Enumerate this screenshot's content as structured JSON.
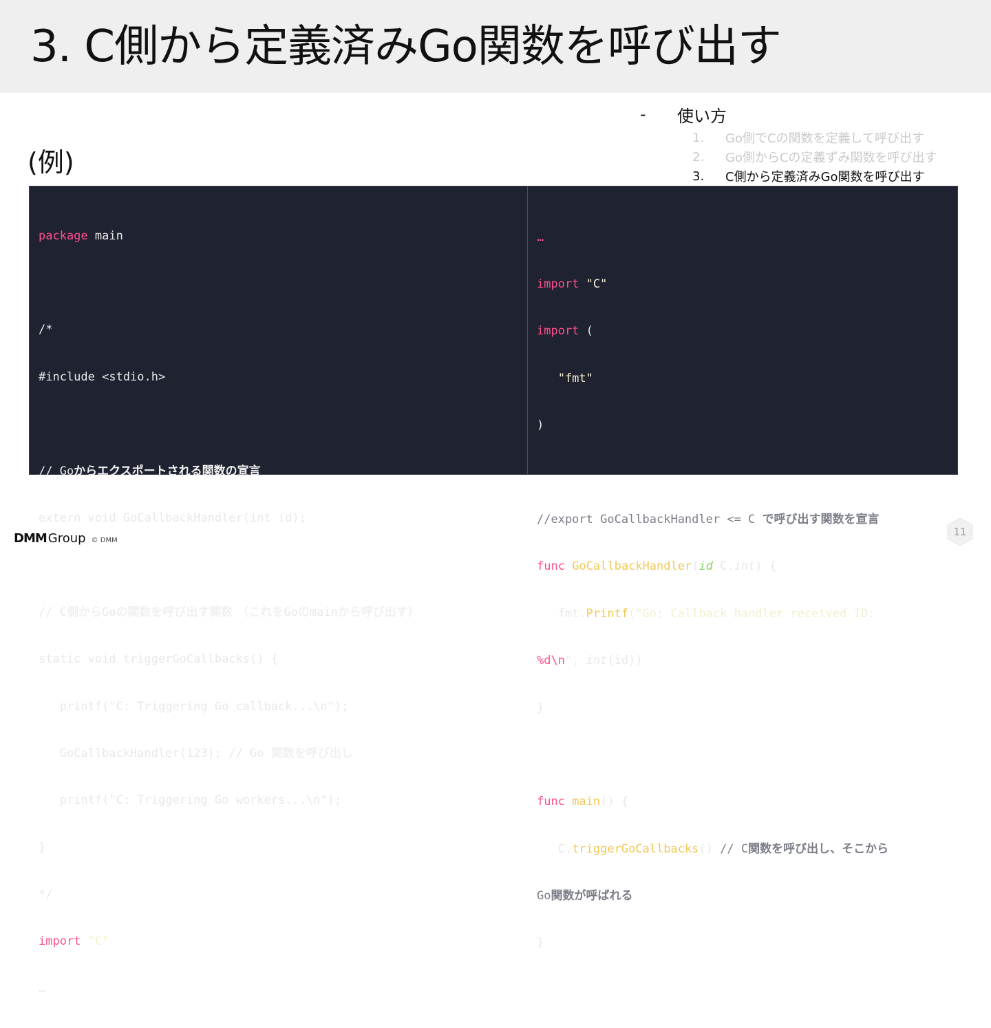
{
  "slide": {
    "title": "3. C側から定義済みGo関数を呼び出す",
    "example_label": "(例)",
    "page_number": "11"
  },
  "usage": {
    "dash": "-",
    "heading": "使い方",
    "items": [
      {
        "num": "1.",
        "label": "Go側でCの関数を定義して呼び出す"
      },
      {
        "num": "2.",
        "label": "Go側からCの定義ずみ関数を呼び出す"
      },
      {
        "num": "3.",
        "label": "C側から定義済みGo関数を呼び出す"
      }
    ]
  },
  "code_left": {
    "l1_kw": "package",
    "l1_rest": " main",
    "l3": "/*",
    "l4": "#include <stdio.h>",
    "l6_a": "// Go",
    "l6_b": "からエクスポートされる関数の宣言",
    "l7": "extern void GoCallbackHandler(int id);",
    "l9_a": "// C",
    "l9_b": "側から",
    "l9_c": "Go",
    "l9_d": "の関数を呼び出す関数 （これを",
    "l9_e": "Go",
    "l9_f": "の",
    "l9_g": "main",
    "l9_h": "から呼び出す）",
    "l10": "static void triggerGoCallbacks() {",
    "l11": "   printf(\"C: Triggering Go callback...\\n\");",
    "l12_a": "   GoCallbackHandler(123); // Go ",
    "l12_b": "関数を呼び出し",
    "l13": "   printf(\"C: Triggering Go workers...\\n\");",
    "l14": "}",
    "l15": "*/",
    "l16_kw": "import",
    "l16_str": " \"C\"",
    "l17": "…"
  },
  "code_right": {
    "r1": "…",
    "r2_kw": "import",
    "r2_str": " \"C\"",
    "r3_kw": "import",
    "r3_rest": " (",
    "r4": "   \"fmt\"",
    "r5": ")",
    "r7_a": "//export GoCallbackHandler <= C ",
    "r7_b": "で呼び出す関数を宣言",
    "r8_kw": "func",
    "r8_fn": " GoCallbackHandler",
    "r8_a": "(",
    "r8_id": "id",
    "r8_b": " C.",
    "r8_int": "int",
    "r8_c": ") {",
    "r9_a": "   fmt.",
    "r9_fn": "Printf",
    "r9_b": "(\"Go: Callback handler received ID:",
    "r10_a": "%d\\n",
    "r10_b": "\", ",
    "r10_int": "int",
    "r10_c": "(id))",
    "r11": "}",
    "r13_kw": "func",
    "r13_fn": " main",
    "r13_rest": "() {",
    "r14_a": "   C.",
    "r14_fn": "triggerGoCallbacks",
    "r14_b": "() ",
    "r14_c": "// C",
    "r14_d": "関数を呼び出し、そこから",
    "r15_a": "Go",
    "r15_b": "関数が呼ばれる",
    "r16": "}"
  },
  "footer": {
    "brand_bold": "DMM",
    "brand_rest": "Group",
    "copyright": "© DMM"
  },
  "colors": {
    "keyword": "#ff4f8b",
    "function": "#f0c85a",
    "comment": "#7b7e88",
    "code_bg": "#1f2230",
    "title_bar_bg": "#efefef"
  }
}
